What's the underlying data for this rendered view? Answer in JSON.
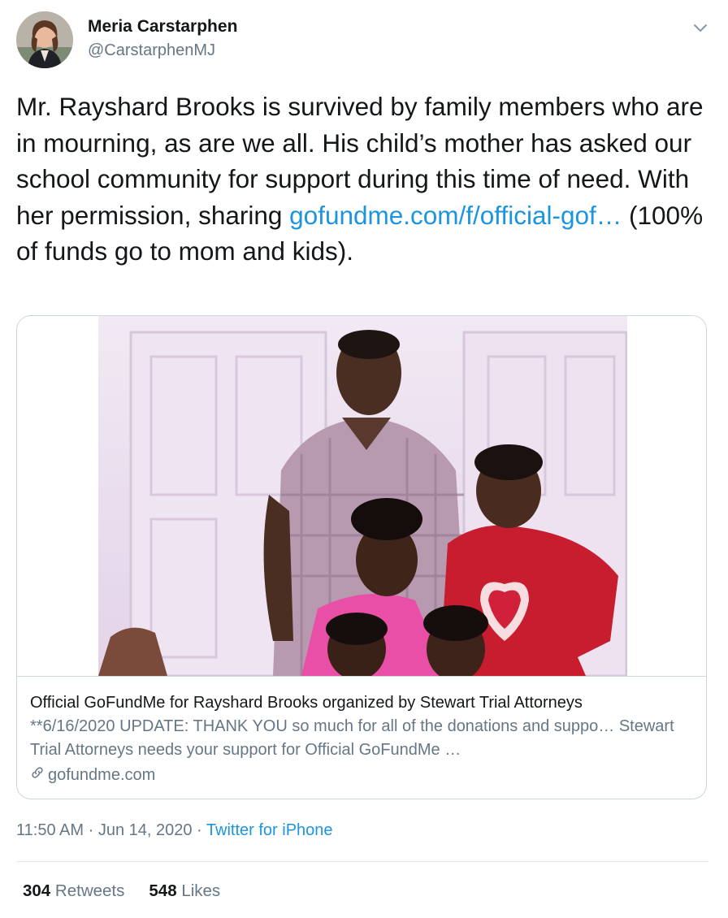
{
  "author": {
    "name": "Meria Carstarphen",
    "handle": "@CarstarphenMJ"
  },
  "tweet": {
    "text_before_link": "Mr. Rayshard Brooks is survived by family members who are in mourning, as are we all. His child’s mother has asked our school community for support during this time of need. With her permission, sharing ",
    "link_text": "gofundme.com/f/official-gof…",
    "text_after_link": " (100% of funds go to mom and kids)."
  },
  "card": {
    "title": "Official GoFundMe for Rayshard Brooks organized by Stewart Trial Attorneys",
    "description": "**6/16/2020 UPDATE: THANK YOU so much for all of the donations and suppo… Stewart Trial Attorneys needs your support for Official GoFundMe …",
    "domain": "gofundme.com"
  },
  "meta": {
    "time": "11:50 AM",
    "date": "Jun 14, 2020",
    "separator": "·",
    "source": "Twitter for iPhone"
  },
  "stats": {
    "retweets_count": "304",
    "retweets_label": "Retweets",
    "likes_count": "548",
    "likes_label": "Likes"
  },
  "colors": {
    "link": "#1b95e0",
    "secondary_text": "#657786",
    "border": "#ccd6dd"
  },
  "icons": {
    "caret": "chevron-down-icon",
    "card_link": "link-icon"
  }
}
